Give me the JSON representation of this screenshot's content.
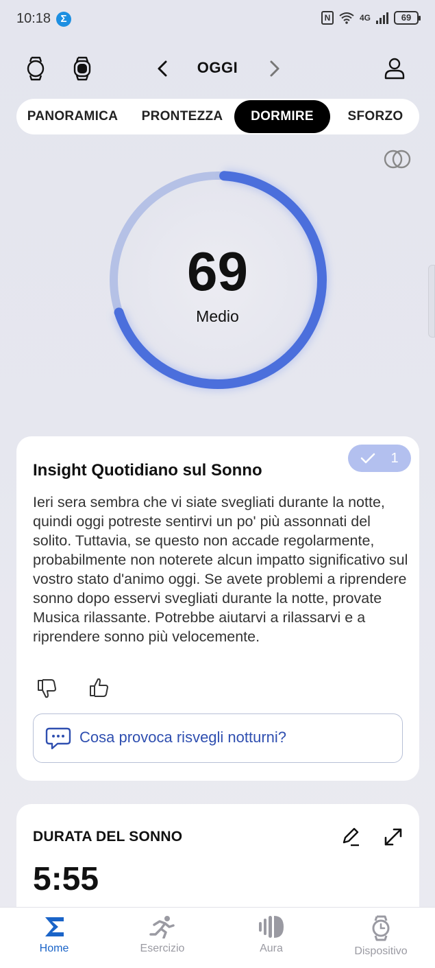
{
  "status_bar": {
    "time": "10:18",
    "app_glyph": "Σ",
    "nfc": "N",
    "network": "4G",
    "battery": "69"
  },
  "header": {
    "title": "OGGI",
    "icons": [
      "watch-round-icon",
      "watch-square-icon",
      "chevron-left-icon",
      "chevron-right-icon",
      "profile-icon"
    ]
  },
  "tabs": [
    {
      "label": "PANORAMICA",
      "active": false
    },
    {
      "label": "PRONTEZZA",
      "active": false
    },
    {
      "label": "DORMIRE",
      "active": true
    },
    {
      "label": "SFORZO",
      "active": false
    }
  ],
  "score": {
    "value": "69",
    "label": "Medio",
    "progress": 0.69,
    "accent": "#4b6fdc",
    "track": "#b5c1e6"
  },
  "insight": {
    "badge_count": "1",
    "title": "Insight Quotidiano sul Sonno",
    "body": "Ieri sera sembra che vi siate svegliati durante la notte, quindi oggi potreste sentirvi un po' più assonnati del solito. Tuttavia, se questo non accade regolarmente, probabilmente non noterete alcun impatto significativo sul vostro stato d'animo oggi. Se avete problemi a riprendere sonno dopo esservi svegliati durante la notte, provate Musica rilassante. Potrebbe aiutarvi a rilassarvi e a riprendere sonno più velocemente.",
    "question": "Cosa provoca risvegli notturni?"
  },
  "sleep_duration": {
    "label": "DURATA DEL SONNO",
    "value": "5:55"
  },
  "bottom_nav": [
    {
      "label": "Home",
      "icon": "sigma-icon",
      "active": true
    },
    {
      "label": "Esercizio",
      "icon": "runner-icon",
      "active": false
    },
    {
      "label": "Aura",
      "icon": "aura-icon",
      "active": false
    },
    {
      "label": "Dispositivo",
      "icon": "device-watch-icon",
      "active": false
    }
  ],
  "colors": {
    "accent_blue": "#1a64c8",
    "active_tab": "#000000",
    "badge": "#b3c0ef",
    "link": "#2f4fb0"
  }
}
